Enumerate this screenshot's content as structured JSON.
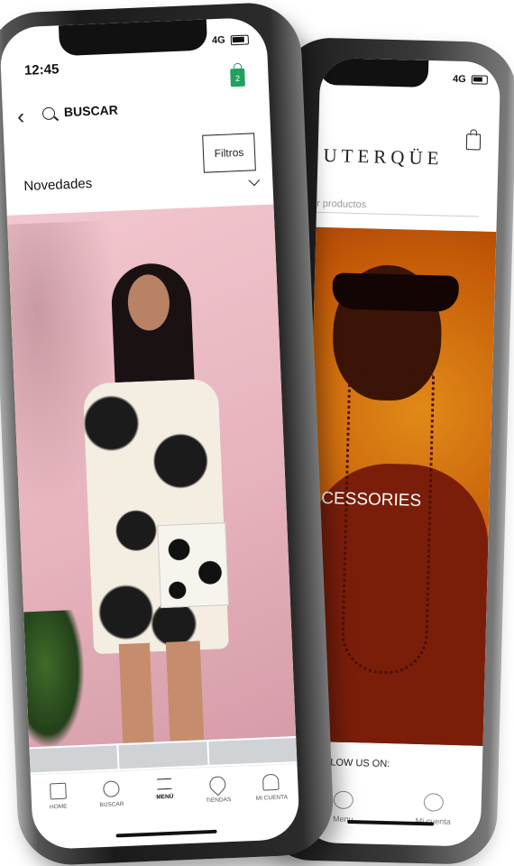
{
  "back_phone": {
    "status": {
      "network": "4G"
    },
    "brand": "UTERQÜE",
    "search_placeholder": "r productos",
    "hero_text": "CCESSORIES",
    "footer_text": "FOLLOW US ON:",
    "tabs": [
      {
        "label": "Menu",
        "icon": "menu-search-icon"
      },
      {
        "label": "Mi cuenta",
        "icon": "user-icon"
      }
    ]
  },
  "front_phone": {
    "status": {
      "time": "12:45",
      "network": "4G"
    },
    "cart_count": "2",
    "search_label": "BUSCAR",
    "filter_label": "Filtros",
    "section_title": "Novedades",
    "tabs": [
      {
        "label": "HOME",
        "icon": "home-icon"
      },
      {
        "label": "BUSCAR",
        "icon": "search-icon"
      },
      {
        "label": "MENÚ",
        "icon": "menu-icon",
        "active": true
      },
      {
        "label": "TIENDAS",
        "icon": "location-pin-icon"
      },
      {
        "label": "MI CUENTA",
        "icon": "user-icon"
      }
    ],
    "colors": {
      "cart": "#1ea25d"
    }
  }
}
